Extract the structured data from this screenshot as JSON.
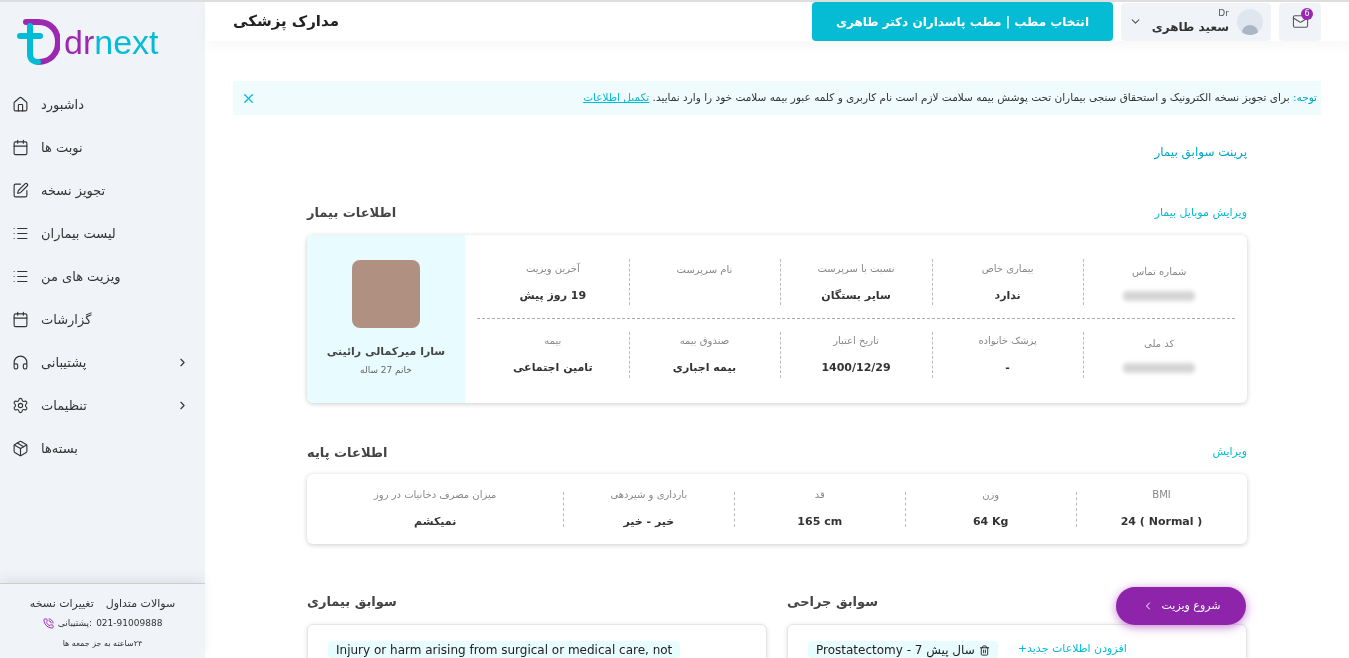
{
  "sidebar": {
    "logo": "drnext",
    "items": [
      {
        "label": "داشبورد",
        "expandable": false
      },
      {
        "label": "نوبت ها",
        "expandable": false
      },
      {
        "label": "تجویز نسخه",
        "expandable": false
      },
      {
        "label": "لیست بیماران",
        "expandable": false
      },
      {
        "label": "ویزیت های من",
        "expandable": false
      },
      {
        "label": "گزارشات",
        "expandable": false
      },
      {
        "label": "پشتیبانی",
        "expandable": true
      },
      {
        "label": "تنظیمات",
        "expandable": true
      },
      {
        "label": "بسته‌ها",
        "expandable": false
      }
    ],
    "footer": {
      "links": [
        "سوالات متداول",
        "تغییرات نسخه"
      ],
      "phone": "021-91009888",
      "phone_label": "پشتیبانی:",
      "hours": "۲۴ساعته به جز جمعه ها"
    }
  },
  "header": {
    "title": "مدارک پزشکی",
    "clinic_button": "انتخاب مطب | مطب پاسداران دکتر طاهری",
    "user": {
      "prefix": "Dr",
      "name": "سعید طاهری"
    },
    "mail_badge": "6"
  },
  "notice": {
    "label": "توجه:",
    "text": "برای تجویز نسخه الکترونیک و استحقاق سنجی بیماران تحت پوشش بیمه سلامت لازم است نام کاربری و کلمه عبور بیمه سلامت خود را وارد نمایید.",
    "link": "تکمیل اطلاعات"
  },
  "print_link": "پرینت سوابق بیمار",
  "patient": {
    "title": "اطلاعات بیمار",
    "edit_link": "ویرایش موبایل بیمار",
    "name": "سارا میرکمالی رائینی",
    "subtitle": "خانم 27 ساله",
    "rows": [
      [
        {
          "label": "شماره تماس",
          "kind": "redacted"
        },
        {
          "label": "بیماری خاص",
          "kind": "text",
          "value": "ندارد"
        },
        {
          "label": "نسبت با سرپرست",
          "kind": "text",
          "value": "سایر بستگان"
        },
        {
          "label": "نام سرپرست",
          "kind": "empty"
        },
        {
          "label": "آخرین ویزیت",
          "kind": "text",
          "value": "19 روز پیش"
        }
      ],
      [
        {
          "label": "کد ملی",
          "kind": "redacted"
        },
        {
          "label": "پزشک خانواده",
          "kind": "text",
          "value": "-"
        },
        {
          "label": "تاریخ اعتبار",
          "kind": "text",
          "value": "1400/12/29"
        },
        {
          "label": "صندوق بیمه",
          "kind": "text",
          "value": "بیمه اجباری"
        },
        {
          "label": "بیمه",
          "kind": "text",
          "value": "تامین اجتماعی"
        }
      ]
    ]
  },
  "basic": {
    "title": "اطلاعات پایه",
    "edit_link": "ویرایش",
    "fields": [
      {
        "label": "BMI",
        "value": "24 ( Normal )"
      },
      {
        "label": "وزن",
        "value": "64 Kg"
      },
      {
        "label": "قد",
        "value": "165 cm"
      },
      {
        "label": "بارداری و شیردهی",
        "value": "خیر - خیر"
      },
      {
        "label": "میزان مصرف دخانیات در روز",
        "value": "نمیکشم"
      }
    ]
  },
  "histories": [
    {
      "title": "سوابق جراحی",
      "add_link": "+افزودن اطلاعات جدید",
      "items": [
        "Prostatectomy - 7 سال پیش"
      ]
    },
    {
      "title": "سوابق بیماری",
      "items": [
        "Injury or harm arising from surgical or medical care, not"
      ]
    }
  ],
  "start_visit_button": "شروع ویزیت"
}
